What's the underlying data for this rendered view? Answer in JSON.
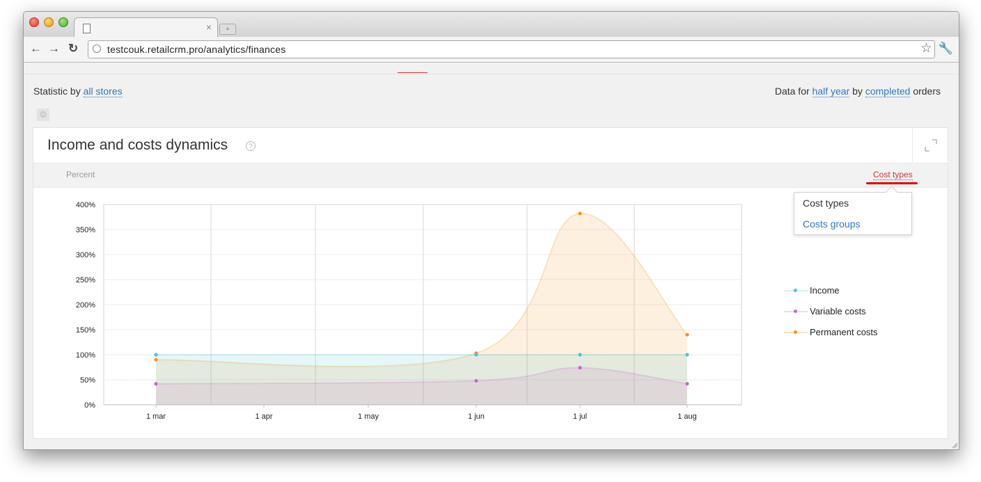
{
  "browser": {
    "url": "testcouk.retailcrm.pro/analytics/finances",
    "tab_close": "×",
    "newtab_label": "+"
  },
  "header": {
    "statistic_prefix": "Statistic by",
    "statistic_link": "all stores",
    "data_for": "Data for",
    "period_link": "half year",
    "by": "by",
    "orders_filter_link": "completed",
    "orders": "orders"
  },
  "card": {
    "title": "Income and costs dynamics",
    "help_glyph": "?",
    "subbar_left": "Percent",
    "subbar_right": "Cost types",
    "dropdown": [
      "Cost types",
      "Costs groups"
    ]
  },
  "legend": [
    {
      "label": "Income",
      "color": "#4fc3d6"
    },
    {
      "label": "Variable costs",
      "color": "#c46bc9"
    },
    {
      "label": "Permanent costs",
      "color": "#f0961c"
    }
  ],
  "chart_data": {
    "type": "area",
    "x": [
      "1 mar",
      "1 apr",
      "1 may",
      "1 jun",
      "1 jul",
      "1 aug"
    ],
    "yticks": [
      "0%",
      "50%",
      "100%",
      "150%",
      "200%",
      "250%",
      "300%",
      "350%",
      "400%"
    ],
    "ylim": [
      0,
      400
    ],
    "series": [
      {
        "name": "Income",
        "color": "#4fc3d6",
        "points": [
          {
            "x": "1 mar",
            "y": 100
          },
          {
            "x": "1 jun",
            "y": 100
          },
          {
            "x": "1 jul",
            "y": 100
          },
          {
            "x": "1 aug",
            "y": 100
          }
        ]
      },
      {
        "name": "Variable costs",
        "color": "#c46bc9",
        "points": [
          {
            "x": "1 mar",
            "y": 42
          },
          {
            "x": "1 jun",
            "y": 48
          },
          {
            "x": "1 jul",
            "y": 74
          },
          {
            "x": "1 aug",
            "y": 42
          }
        ]
      },
      {
        "name": "Permanent costs",
        "color": "#f0961c",
        "points": [
          {
            "x": "1 mar",
            "y": 90
          },
          {
            "x": "1 jun",
            "y": 103
          },
          {
            "x": "1 jul",
            "y": 382
          },
          {
            "x": "1 aug",
            "y": 140
          }
        ]
      }
    ],
    "grid": true,
    "legend": "right"
  }
}
